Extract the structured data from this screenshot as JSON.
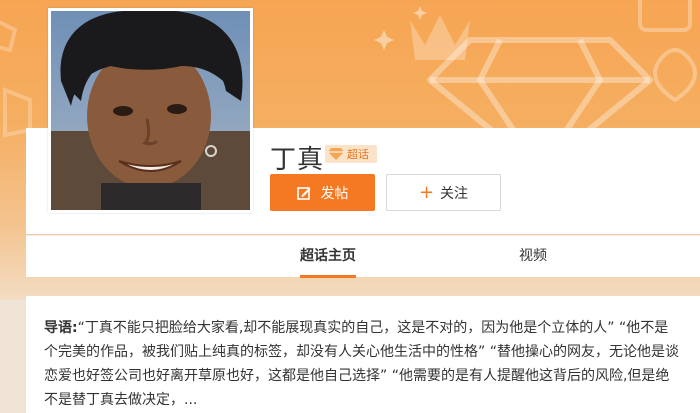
{
  "profile": {
    "name": "丁真",
    "badge": "超话"
  },
  "actions": {
    "post_label": "发帖",
    "follow_label": "关注"
  },
  "tabs": [
    {
      "label": "超话主页",
      "active": true
    },
    {
      "label": "视频",
      "active": false
    }
  ],
  "intro": {
    "label": "导语:",
    "text": "“丁真不能只把脸给大家看,却不能展现真实的自己，这是不对的，因为他是个立体的人” “他不是个完美的作品，被我们贴上纯真的标签，却没有人关心他生活中的性格” “替他操心的网友，无论他是谈恋爱也好签公司也好离开草原也好，这都是他自己选择” “他需要的是有人提醒他这背后的风险,但是绝不是替丁真去做决定，..."
  },
  "colors": {
    "accent": "#f57922",
    "banner": "#f6a553",
    "page_bg": "#f0e4d6"
  },
  "icons": {
    "post": "edit-icon",
    "follow": "plus-icon",
    "badge": "diamond-icon"
  }
}
